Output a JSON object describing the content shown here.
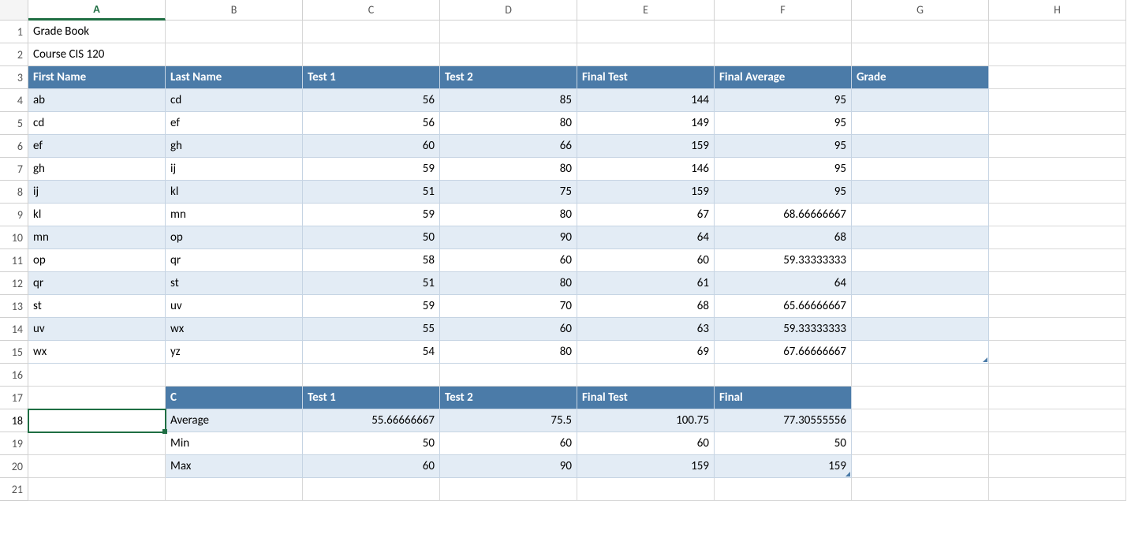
{
  "columns": [
    "A",
    "B",
    "C",
    "D",
    "E",
    "F",
    "G",
    "H"
  ],
  "title_row1": "Grade Book",
  "title_row2": "Course CIS 120",
  "active_col_index": 0,
  "selected_row": 18,
  "table1": {
    "headers": [
      "First Name",
      "Last Name",
      "Test 1",
      "Test 2",
      "Final Test",
      "Final Average",
      "Grade"
    ],
    "rows": [
      {
        "r": 4,
        "fn": "ab",
        "ln": "cd",
        "t1": "56",
        "t2": "85",
        "ft": "144",
        "fa": "95",
        "g": ""
      },
      {
        "r": 5,
        "fn": "cd",
        "ln": "ef",
        "t1": "56",
        "t2": "80",
        "ft": "149",
        "fa": "95",
        "g": ""
      },
      {
        "r": 6,
        "fn": "ef",
        "ln": "gh",
        "t1": "60",
        "t2": "66",
        "ft": "159",
        "fa": "95",
        "g": ""
      },
      {
        "r": 7,
        "fn": "gh",
        "ln": "ij",
        "t1": "59",
        "t2": "80",
        "ft": "146",
        "fa": "95",
        "g": ""
      },
      {
        "r": 8,
        "fn": "ij",
        "ln": "kl",
        "t1": "51",
        "t2": "75",
        "ft": "159",
        "fa": "95",
        "g": ""
      },
      {
        "r": 9,
        "fn": "kl",
        "ln": "mn",
        "t1": "59",
        "t2": "80",
        "ft": "67",
        "fa": "68.66666667",
        "g": ""
      },
      {
        "r": 10,
        "fn": "mn",
        "ln": "op",
        "t1": "50",
        "t2": "90",
        "ft": "64",
        "fa": "68",
        "g": ""
      },
      {
        "r": 11,
        "fn": "op",
        "ln": "qr",
        "t1": "58",
        "t2": "60",
        "ft": "60",
        "fa": "59.33333333",
        "g": ""
      },
      {
        "r": 12,
        "fn": "qr",
        "ln": "st",
        "t1": "51",
        "t2": "80",
        "ft": "61",
        "fa": "64",
        "g": ""
      },
      {
        "r": 13,
        "fn": "st",
        "ln": "uv",
        "t1": "59",
        "t2": "70",
        "ft": "68",
        "fa": "65.66666667",
        "g": ""
      },
      {
        "r": 14,
        "fn": "uv",
        "ln": "wx",
        "t1": "55",
        "t2": "60",
        "ft": "63",
        "fa": "59.33333333",
        "g": ""
      },
      {
        "r": 15,
        "fn": "wx",
        "ln": "yz",
        "t1": "54",
        "t2": "80",
        "ft": "69",
        "fa": "67.66666667",
        "g": ""
      }
    ]
  },
  "table2": {
    "header_row": 17,
    "headers": [
      "C",
      "Test 1",
      "Test 2",
      "Final Test",
      "Final"
    ],
    "rows": [
      {
        "r": 18,
        "label": "Average",
        "t1": "55.66666667",
        "t2": "75.5",
        "ft": "100.75",
        "fin": "77.30555556"
      },
      {
        "r": 19,
        "label": "Min",
        "t1": "50",
        "t2": "60",
        "ft": "60",
        "fin": "50"
      },
      {
        "r": 20,
        "label": "Max",
        "t1": "60",
        "t2": "90",
        "ft": "159",
        "fin": "159"
      }
    ]
  },
  "extra_rows": [
    16,
    21
  ],
  "chart_data": {
    "type": "table",
    "title": "Grade Book — Course CIS 120",
    "columns": [
      "First Name",
      "Last Name",
      "Test 1",
      "Test 2",
      "Final Test",
      "Final Average",
      "Grade"
    ],
    "data": [
      [
        "ab",
        "cd",
        56,
        85,
        144,
        95,
        null
      ],
      [
        "cd",
        "ef",
        56,
        80,
        149,
        95,
        null
      ],
      [
        "ef",
        "gh",
        60,
        66,
        159,
        95,
        null
      ],
      [
        "gh",
        "ij",
        59,
        80,
        146,
        95,
        null
      ],
      [
        "ij",
        "kl",
        51,
        75,
        159,
        95,
        null
      ],
      [
        "kl",
        "mn",
        59,
        80,
        67,
        68.66666667,
        null
      ],
      [
        "mn",
        "op",
        50,
        90,
        64,
        68,
        null
      ],
      [
        "op",
        "qr",
        58,
        60,
        60,
        59.33333333,
        null
      ],
      [
        "qr",
        "st",
        51,
        80,
        61,
        64,
        null
      ],
      [
        "st",
        "uv",
        59,
        70,
        68,
        65.66666667,
        null
      ],
      [
        "uv",
        "wx",
        55,
        60,
        63,
        59.33333333,
        null
      ],
      [
        "wx",
        "yz",
        54,
        80,
        69,
        67.66666667,
        null
      ]
    ],
    "summary": {
      "columns": [
        "",
        "Test 1",
        "Test 2",
        "Final Test",
        "Final"
      ],
      "Average": [
        55.66666667,
        75.5,
        100.75,
        77.30555556
      ],
      "Min": [
        50,
        60,
        60,
        50
      ],
      "Max": [
        60,
        90,
        159,
        159
      ]
    }
  }
}
